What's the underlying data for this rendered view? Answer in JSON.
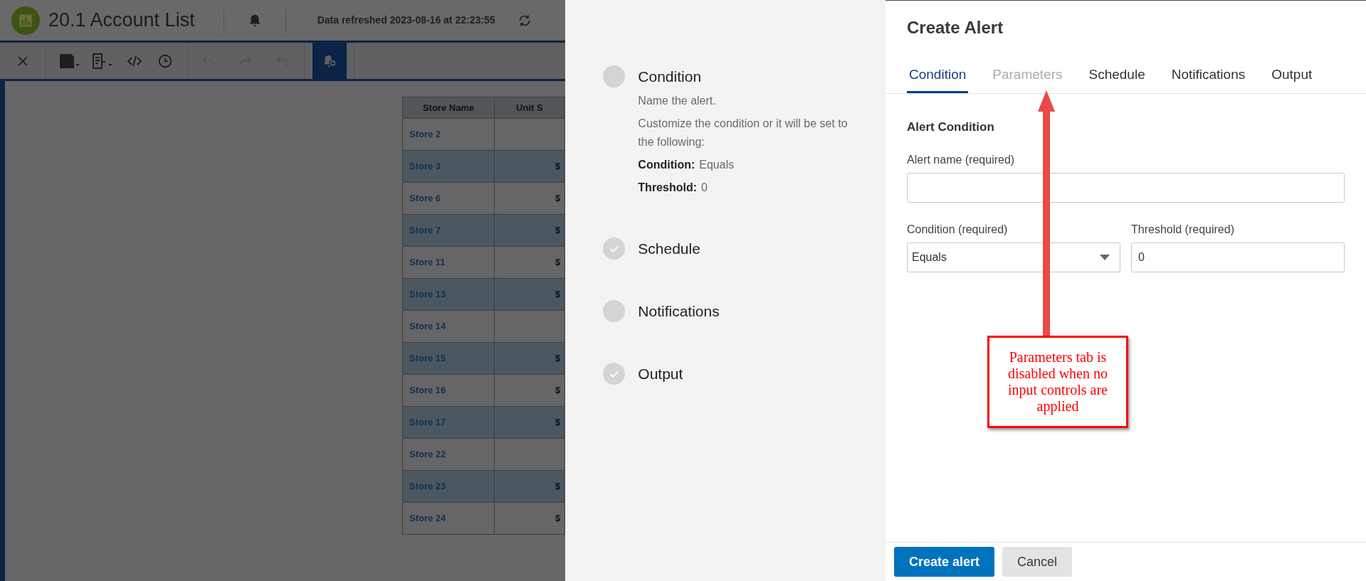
{
  "app": {
    "title": "20.1 Account List",
    "refreshed": "Data refreshed 2023-08-16 at 22:23:55"
  },
  "table": {
    "columns": [
      "Store Name",
      "Unit S"
    ],
    "rows": [
      {
        "store": "Store 2",
        "highlighted": false
      },
      {
        "store": "Store 3",
        "column_2": "$",
        "highlighted": true
      },
      {
        "store": "Store 6",
        "column_2": "$",
        "highlighted": false
      },
      {
        "store": "Store 7",
        "column_2": "$",
        "highlighted": true
      },
      {
        "store": "Store 11",
        "column_2": "$",
        "highlighted": false
      },
      {
        "store": "Store 13",
        "column_2": "$",
        "highlighted": true
      },
      {
        "store": "Store 14",
        "highlighted": false
      },
      {
        "store": "Store 15",
        "column_2": "$",
        "highlighted": true
      },
      {
        "store": "Store 16",
        "column_2": "$",
        "highlighted": false
      },
      {
        "store": "Store 17",
        "column_2": "$",
        "highlighted": true
      },
      {
        "store": "Store 22",
        "highlighted": false
      },
      {
        "store": "Store 23",
        "column_2": "$",
        "highlighted": true
      },
      {
        "store": "Store 24",
        "column_2": "$",
        "highlighted": false
      }
    ]
  },
  "steps": [
    {
      "label": "Condition",
      "checked": false,
      "details": [
        "Name the alert.",
        "Customize the condition or it will be set to the following:"
      ],
      "summary": [
        {
          "label": "Condition:",
          "value": "Equals"
        },
        {
          "label": "Threshold:",
          "value": "0"
        }
      ]
    },
    {
      "label": "Schedule",
      "checked": true
    },
    {
      "label": "Notifications",
      "checked": false
    },
    {
      "label": "Output",
      "checked": true
    }
  ],
  "dialog": {
    "title": "Create Alert",
    "tabs": [
      {
        "label": "Condition",
        "selected": true,
        "disabled": false
      },
      {
        "label": "Parameters",
        "selected": false,
        "disabled": true
      },
      {
        "label": "Schedule",
        "selected": false,
        "disabled": false
      },
      {
        "label": "Notifications",
        "selected": false,
        "disabled": false
      },
      {
        "label": "Output",
        "selected": false,
        "disabled": false
      }
    ],
    "section": "Alert Condition",
    "alert_name": {
      "label": "Alert name (required)"
    },
    "condition": {
      "label": "Condition (required)",
      "value": "Equals"
    },
    "threshold": {
      "label": "Threshold (required)",
      "value": "0"
    },
    "buttons": [
      {
        "label": "Create alert",
        "kind": "primary"
      },
      {
        "label": "Cancel",
        "kind": "secondary"
      }
    ]
  },
  "annotation": "Parameters tab is disabled when no input controls are applied"
}
